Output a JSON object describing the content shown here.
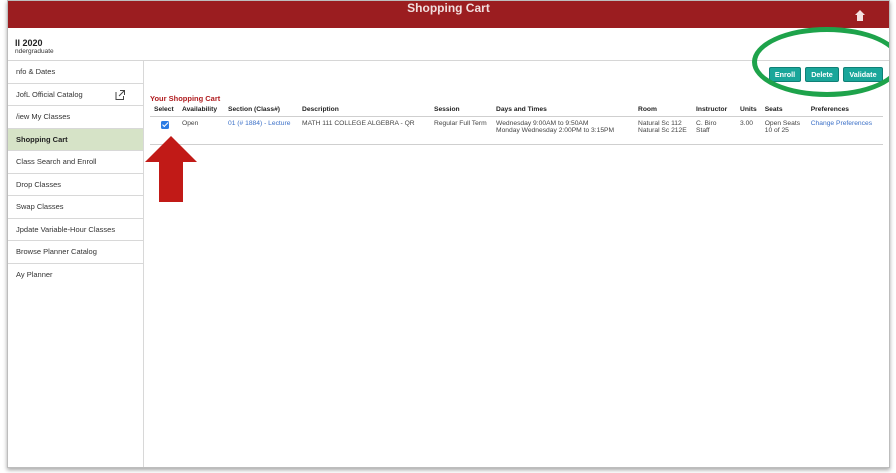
{
  "header": {
    "app_title": "",
    "page_heading": "Shopping Cart"
  },
  "term": {
    "name": "ll 2020",
    "career": "ndergraduate"
  },
  "sidebar": {
    "items": [
      {
        "label": "nfo & Dates",
        "active": false
      },
      {
        "label": "JofL Official Catalog",
        "active": false,
        "icon": "external-link-icon"
      },
      {
        "label": "/iew My Classes",
        "active": false
      },
      {
        "label": "Shopping Cart",
        "active": true
      },
      {
        "label": "Class Search and Enroll",
        "active": false
      },
      {
        "label": "Drop Classes",
        "active": false
      },
      {
        "label": "Swap Classes",
        "active": false
      },
      {
        "label": "Jpdate Variable-Hour Classes",
        "active": false
      },
      {
        "label": "Browse Planner Catalog",
        "active": false
      },
      {
        "label": "Ay Planner",
        "active": false
      }
    ]
  },
  "actions": {
    "enroll_label": "Enroll",
    "delete_label": "Delete",
    "validate_label": "Validate"
  },
  "cart": {
    "title": "Your Shopping Cart",
    "columns": [
      "Select",
      "Availability",
      "Section (Class#)",
      "Description",
      "Session",
      "Days and Times",
      "Room",
      "Instructor",
      "Units",
      "Seats",
      "Preferences"
    ],
    "rows": [
      {
        "selected": true,
        "availability": "Open",
        "section": "01 (# 1884) - Lecture",
        "description": "MATH 111 COLLEGE ALGEBRA - QR",
        "session": "Regular Full Term",
        "times_line1": "Wednesday  9:00AM to 9:50AM",
        "times_line2": "Monday Wednesday  2:00PM to 3:15PM",
        "room_line1": "Natural Sc 112",
        "room_line2": "Natural Sc 212E",
        "instructor_line1": "C. Biro",
        "instructor_line2": "Staff",
        "units": "3.00",
        "seats_line1": "Open Seats",
        "seats_line2": "10 of 25",
        "preferences": "Change Preferences"
      }
    ]
  },
  "colors": {
    "header_bg": "#9b1d20",
    "accent_button": "#1aa69a",
    "active_nav": "#d6e3c7",
    "link": "#3a6fc7",
    "annotation_ring": "#1ea34b",
    "annotation_arrow": "#c11a17"
  }
}
